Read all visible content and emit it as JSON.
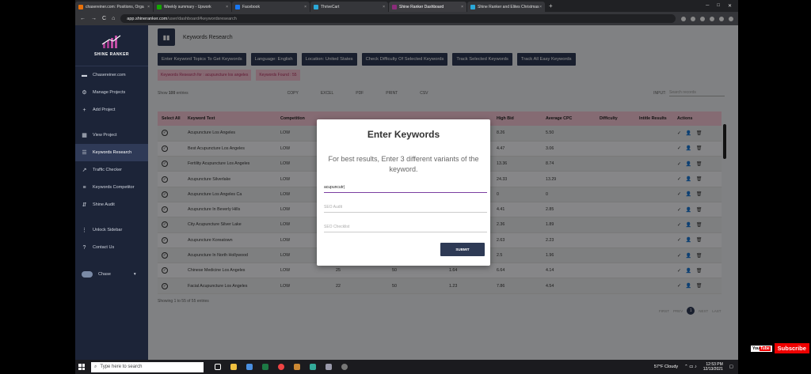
{
  "browser": {
    "tabs": [
      {
        "title": "chasereiner.com: Positions, Orga",
        "color": "#e8710a"
      },
      {
        "title": "Weekly summary - Upwork",
        "color": "#14a800"
      },
      {
        "title": "Facebook",
        "color": "#1877f2"
      },
      {
        "title": "ThriveCart",
        "color": "#2aa8d8"
      },
      {
        "title": "Shine Ranker Dashboard",
        "color": "#8b2c7a",
        "active": true
      },
      {
        "title": "Shine Ranker and Elites Christmas",
        "color": "#2aa8d8"
      }
    ],
    "url_host": "app.shineranker.com",
    "url_path": "/user/dashboard#keywordsresearch",
    "back": "←",
    "forward": "→",
    "reload": "C",
    "home": "⌂",
    "new_tab": "+",
    "win_min": "─",
    "win_max": "□",
    "win_close": "✕"
  },
  "sidebar": {
    "brand": "SHINE RANKER",
    "items": [
      {
        "label": "Chasereiner.com",
        "icon": "site-icon",
        "glyph": "▬"
      },
      {
        "label": "Manage Projects",
        "icon": "gear-icon",
        "glyph": "⚙"
      },
      {
        "label": "Add Project",
        "icon": "plus-icon",
        "glyph": "+"
      },
      {
        "label": "View Project",
        "icon": "grid-icon",
        "glyph": "▦"
      },
      {
        "label": "Keywords Research",
        "icon": "list-icon",
        "glyph": "☰",
        "active": true
      },
      {
        "label": "Traffic Checker",
        "icon": "trend-icon",
        "glyph": "↗"
      },
      {
        "label": "Keywords Competitor",
        "icon": "compare-icon",
        "glyph": "≡"
      },
      {
        "label": "Shine Audit",
        "icon": "sliders-icon",
        "glyph": "⇵"
      },
      {
        "label": "Unlock Sidebar",
        "icon": "more-vertical-icon",
        "glyph": "⋮"
      },
      {
        "label": "Contact Us",
        "icon": "help-icon",
        "glyph": "?"
      }
    ],
    "user": {
      "name": "Chase",
      "caret": "▾"
    }
  },
  "page": {
    "title": "Keywords Research",
    "buttons": [
      "Enter Keyword Topics To Get Keywords",
      "Language: English",
      "Location: United States",
      "Check Difficulty Of Selected Keywords",
      "Track Selected Keywords",
      "Track All Easy Keywords"
    ],
    "pills": [
      "Keywords Research for : acupuncture los angeles",
      "Keywords Found : 55"
    ],
    "show_prefix": "Show",
    "show_count": "100",
    "show_suffix": "entries",
    "exports": [
      "COPY",
      "EXCEL",
      "PDF",
      "PRINT",
      "CSV"
    ],
    "search_label": "INPUT:",
    "search_placeholder": "Search records",
    "table": {
      "headers": [
        "Select All",
        "Keyword Text",
        "Competition",
        "",
        "",
        "",
        "High Bid",
        "Average CPC",
        "Difficulty",
        "Intitle Results",
        "Actions"
      ],
      "rows": [
        [
          "Acupuncture Los Angeles",
          "LOW",
          "",
          "",
          "",
          "8.26",
          "5.50"
        ],
        [
          "Best Acupuncture Los Angeles",
          "LOW",
          "",
          "",
          "",
          "4.47",
          "3.06"
        ],
        [
          "Fertility Acupuncture Los Angeles",
          "LOW",
          "",
          "",
          "",
          "13.36",
          "8.74"
        ],
        [
          "Acupuncture Silverlake",
          "LOW",
          "",
          "",
          "",
          "24.33",
          "13.29"
        ],
        [
          "Acupuncture Los Angeles Ca",
          "LOW",
          "",
          "",
          "",
          "0",
          "0"
        ],
        [
          "Acupuncture In Beverly Hills",
          "LOW",
          "",
          "",
          "",
          "4.41",
          "2.85"
        ],
        [
          "City Acupuncture Silver Lake",
          "LOW",
          "",
          "",
          "",
          "2.36",
          "1.89"
        ],
        [
          "Acupuncture Koreatown",
          "LOW",
          "",
          "",
          "",
          "2.63",
          "2.23"
        ],
        [
          "Acupuncture In North Hollywood",
          "LOW",
          "",
          "",
          "",
          "2.5",
          "1.96"
        ],
        [
          "Chinese Medicine Los Angeles",
          "LOW",
          "25",
          "50",
          "1.64",
          "6.64",
          "4.14"
        ],
        [
          "Facial Acupuncture Los Angeles",
          "LOW",
          "22",
          "50",
          "1.23",
          "7.86",
          "4.54"
        ]
      ]
    },
    "check_glyph": "✓",
    "action_glyphs": "✓ 👤 🗑",
    "footer": "Showing 1 to 55 of 55 entries",
    "pager": {
      "first": "FIRST",
      "prev": "PREV",
      "current": "1",
      "next": "NEXT",
      "last": "LAST"
    }
  },
  "modal": {
    "title": "Enter Keywords",
    "description": "For best results, Enter 3 different variants of the keyword.",
    "input_value": "acupuncutr|",
    "field2_placeholder": "SEO Audit",
    "field3_placeholder": "SEO Checklist",
    "submit": "SUBMIT"
  },
  "taskbar": {
    "search_placeholder": "Type here to search",
    "weather": "57°F  Cloudy",
    "time": "12:53 PM",
    "date": "12/13/2021"
  },
  "youtube": {
    "logo_you": "You",
    "logo_tube": "Tube",
    "subscribe": "Subscribe"
  }
}
